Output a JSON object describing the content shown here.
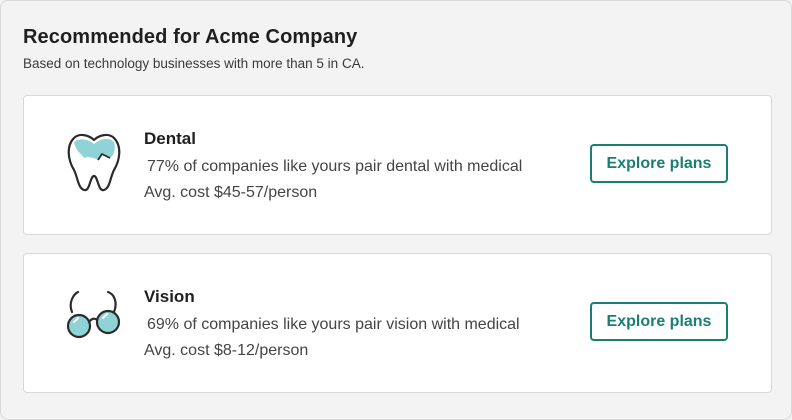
{
  "header": {
    "title": "Recommended for Acme Company",
    "subtitle": "Based on technology businesses with more than 5 in CA."
  },
  "cards": [
    {
      "icon": "tooth-icon",
      "title": "Dental",
      "description": "77% of companies like yours pair dental with medical",
      "cost": "Avg. cost $45-57/person",
      "button_label": "Explore plans"
    },
    {
      "icon": "glasses-icon",
      "title": "Vision",
      "description": "69% of companies like yours pair vision with medical",
      "cost": "Avg. cost $8-12/person",
      "button_label": "Explore plans"
    }
  ],
  "colors": {
    "accent": "#1a7e74",
    "illustration_fill": "#8fd3d6"
  }
}
